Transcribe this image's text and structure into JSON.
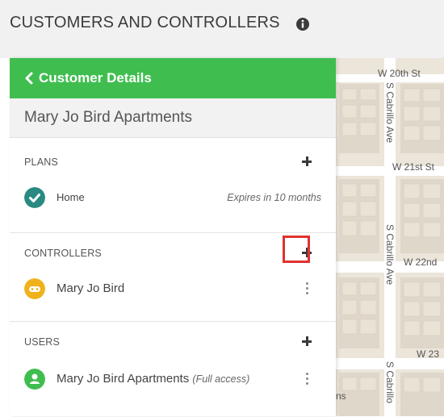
{
  "header": {
    "title": "CUSTOMERS AND CONTROLLERS",
    "info_icon": "info-circle-icon"
  },
  "panel": {
    "back_label": "Customer Details",
    "customer_name": "Mary Jo Bird Apartments",
    "plans": {
      "label": "PLANS",
      "items": [
        {
          "name": "Home",
          "status": "Expires in 10 months",
          "icon": "check-circle-icon",
          "icon_color": "#2a8a82"
        }
      ]
    },
    "controllers": {
      "label": "CONTROLLERS",
      "items": [
        {
          "name": "Mary Jo Bird",
          "icon": "controller-icon",
          "icon_color": "#f0b21a"
        }
      ]
    },
    "users": {
      "label": "USERS",
      "items": [
        {
          "name": "Mary Jo Bird Apartments",
          "access": "(Full access)",
          "icon": "user-icon",
          "icon_color": "#3fbe4f"
        }
      ]
    }
  },
  "highlight_color": "#e0312f",
  "map": {
    "labels": [
      "W 20th St",
      "S Cabrillo Ave",
      "W 21st St",
      "S Cabrillo Ave",
      "W 22nd",
      "W 23",
      "S Cabrillo",
      "ns"
    ]
  }
}
